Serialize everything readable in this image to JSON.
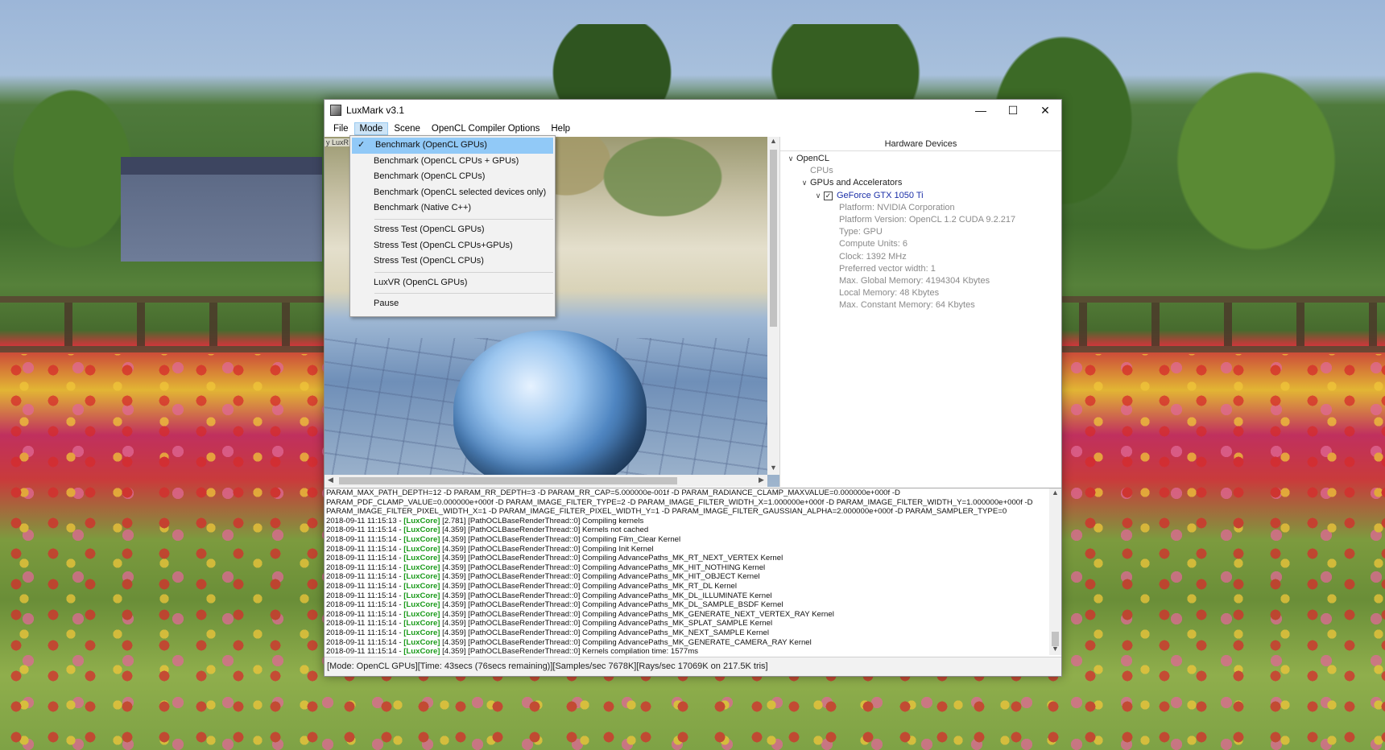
{
  "window": {
    "title": "LuxMark v3.1",
    "controls": {
      "minimize": "—",
      "maximize": "☐",
      "close": "✕"
    }
  },
  "menubar": [
    "File",
    "Mode",
    "Scene",
    "OpenCL Compiler Options",
    "Help"
  ],
  "mode_menu": {
    "group1": [
      "Benchmark (OpenCL GPUs)",
      "Benchmark (OpenCL CPUs + GPUs)",
      "Benchmark (OpenCL CPUs)",
      "Benchmark (OpenCL selected devices only)",
      "Benchmark (Native C++)"
    ],
    "group2": [
      "Stress Test (OpenCL GPUs)",
      "Stress Test (OpenCL CPUs+GPUs)",
      "Stress Test (OpenCL CPUs)"
    ],
    "group3": [
      "LuxVR (OpenCL GPUs)"
    ],
    "group4": [
      "Pause"
    ],
    "check": "✓"
  },
  "render": {
    "overlay_label": "y LuxR"
  },
  "devices": {
    "header": "Hardware Devices",
    "opencl": "OpenCL",
    "cpus": "CPUs",
    "gpus": "GPUs and Accelerators",
    "gpu_name": "GeForce GTX 1050 Ti",
    "details": [
      "Platform: NVIDIA Corporation",
      "Platform Version: OpenCL 1.2 CUDA 9.2.217",
      "Type: GPU",
      "Compute Units: 6",
      "Clock: 1392 MHz",
      "Preferred vector width: 1",
      "Max. Global Memory: 4194304 Kbytes",
      "Local Memory: 48 Kbytes",
      "Max. Constant Memory: 64 Kbytes"
    ]
  },
  "log": {
    "header_lines": [
      "PARAM_MAX_PATH_DEPTH=12 -D PARAM_RR_DEPTH=3 -D PARAM_RR_CAP=5.000000e-001f -D PARAM_RADIANCE_CLAMP_MAXVALUE=0.000000e+000f -D",
      "PARAM_PDF_CLAMP_VALUE=0.000000e+000f -D PARAM_IMAGE_FILTER_TYPE=2 -D PARAM_IMAGE_FILTER_WIDTH_X=1.000000e+000f -D PARAM_IMAGE_FILTER_WIDTH_Y=1.000000e+000f -D",
      "PARAM_IMAGE_FILTER_PIXEL_WIDTH_X=1 -D PARAM_IMAGE_FILTER_PIXEL_WIDTH_Y=1 -D PARAM_IMAGE_FILTER_GAUSSIAN_ALPHA=2.000000e+000f -D PARAM_SAMPLER_TYPE=0"
    ],
    "tag": "[LuxCore]",
    "entries": [
      {
        "time": "2018-09-11 11:15:13 - ",
        "msg": " [2.781] [PathOCLBaseRenderThread::0] Compiling kernels"
      },
      {
        "time": "2018-09-11 11:15:14 - ",
        "msg": " [4.359] [PathOCLBaseRenderThread::0] Kernels not cached"
      },
      {
        "time": "2018-09-11 11:15:14 - ",
        "msg": " [4.359] [PathOCLBaseRenderThread::0] Compiling Film_Clear Kernel"
      },
      {
        "time": "2018-09-11 11:15:14 - ",
        "msg": " [4.359] [PathOCLBaseRenderThread::0] Compiling Init Kernel"
      },
      {
        "time": "2018-09-11 11:15:14 - ",
        "msg": " [4.359] [PathOCLBaseRenderThread::0] Compiling AdvancePaths_MK_RT_NEXT_VERTEX Kernel"
      },
      {
        "time": "2018-09-11 11:15:14 - ",
        "msg": " [4.359] [PathOCLBaseRenderThread::0] Compiling AdvancePaths_MK_HIT_NOTHING Kernel"
      },
      {
        "time": "2018-09-11 11:15:14 - ",
        "msg": " [4.359] [PathOCLBaseRenderThread::0] Compiling AdvancePaths_MK_HIT_OBJECT Kernel"
      },
      {
        "time": "2018-09-11 11:15:14 - ",
        "msg": " [4.359] [PathOCLBaseRenderThread::0] Compiling AdvancePaths_MK_RT_DL Kernel"
      },
      {
        "time": "2018-09-11 11:15:14 - ",
        "msg": " [4.359] [PathOCLBaseRenderThread::0] Compiling AdvancePaths_MK_DL_ILLUMINATE Kernel"
      },
      {
        "time": "2018-09-11 11:15:14 - ",
        "msg": " [4.359] [PathOCLBaseRenderThread::0] Compiling AdvancePaths_MK_DL_SAMPLE_BSDF Kernel"
      },
      {
        "time": "2018-09-11 11:15:14 - ",
        "msg": " [4.359] [PathOCLBaseRenderThread::0] Compiling AdvancePaths_MK_GENERATE_NEXT_VERTEX_RAY Kernel"
      },
      {
        "time": "2018-09-11 11:15:14 - ",
        "msg": " [4.359] [PathOCLBaseRenderThread::0] Compiling AdvancePaths_MK_SPLAT_SAMPLE Kernel"
      },
      {
        "time": "2018-09-11 11:15:14 - ",
        "msg": " [4.359] [PathOCLBaseRenderThread::0] Compiling AdvancePaths_MK_NEXT_SAMPLE Kernel"
      },
      {
        "time": "2018-09-11 11:15:14 - ",
        "msg": " [4.359] [PathOCLBaseRenderThread::0] Compiling AdvancePaths_MK_GENERATE_CAMERA_RAY Kernel"
      },
      {
        "time": "2018-09-11 11:15:14 - ",
        "msg": " [4.359] [PathOCLBaseRenderThread::0] Kernels compilation time: 1577ms"
      }
    ]
  },
  "status": "[Mode: OpenCL GPUs][Time: 43secs (76secs remaining)][Samples/sec  7678K][Rays/sec  17069K on 217.5K tris]",
  "colors": {
    "log_tag": "#1a9a1a",
    "menu_highlight": "#91c9f7",
    "gpu_name": "#1b2fa8"
  },
  "icons": {
    "expand": "chevron-down-icon",
    "checkbox": "checkbox-checked-icon",
    "app": "luxmark-app-icon"
  }
}
